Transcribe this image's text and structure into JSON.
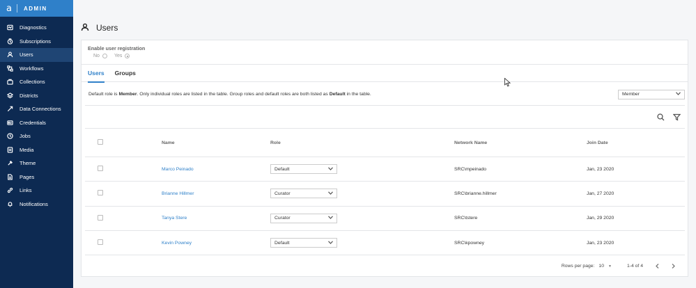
{
  "brand": {
    "logo": "a",
    "title": "ADMIN"
  },
  "sidebar": {
    "items": [
      {
        "label": "Diagnostics",
        "icon": "diagnostics-icon",
        "active": false
      },
      {
        "label": "Subscriptions",
        "icon": "subscriptions-icon",
        "active": false
      },
      {
        "label": "Users",
        "icon": "user-icon",
        "active": true
      },
      {
        "label": "Workflows",
        "icon": "workflows-icon",
        "active": false
      },
      {
        "label": "Collections",
        "icon": "collections-icon",
        "active": false
      },
      {
        "label": "Districts",
        "icon": "districts-icon",
        "active": false
      },
      {
        "label": "Data Connections",
        "icon": "data-connections-icon",
        "active": false
      },
      {
        "label": "Credentials",
        "icon": "credentials-icon",
        "active": false
      },
      {
        "label": "Jobs",
        "icon": "jobs-icon",
        "active": false
      },
      {
        "label": "Media",
        "icon": "media-icon",
        "active": false
      },
      {
        "label": "Theme",
        "icon": "theme-icon",
        "active": false
      },
      {
        "label": "Pages",
        "icon": "pages-icon",
        "active": false
      },
      {
        "label": "Links",
        "icon": "links-icon",
        "active": false
      },
      {
        "label": "Notifications",
        "icon": "notifications-icon",
        "active": false
      }
    ]
  },
  "header": {
    "title": "Users",
    "icon": "user-icon"
  },
  "registration": {
    "label": "Enable user registration",
    "option_no": "No",
    "option_yes": "Yes",
    "selected": "Yes"
  },
  "tabs": [
    {
      "label": "Users",
      "active": true
    },
    {
      "label": "Groups",
      "active": false
    }
  ],
  "info": {
    "prefix": "Default role is ",
    "role": "Member",
    "middle": ". Only individual roles are listed in the table. Group roles and default roles are both listed as ",
    "default_word": "Default",
    "suffix": " in the table.",
    "default_role_select": "Member"
  },
  "table": {
    "columns": {
      "name": "Name",
      "role": "Role",
      "network": "Network Name",
      "join": "Join Date"
    },
    "rows": [
      {
        "name": "Marco Peinado",
        "role": "Default",
        "network": "SRC\\mpeinado",
        "join": "Jan, 23 2020"
      },
      {
        "name": "Brianne Hillmer",
        "role": "Curator",
        "network": "SRC\\brianne.hillmer",
        "join": "Jan, 27 2020"
      },
      {
        "name": "Tanya Stere",
        "role": "Curator",
        "network": "SRC\\tstere",
        "join": "Jan, 29 2020"
      },
      {
        "name": "Kevin Powney",
        "role": "Default",
        "network": "SRC\\kpowney",
        "join": "Jan, 23 2020"
      }
    ]
  },
  "pager": {
    "rows_label": "Rows per page:",
    "rows_value": "10",
    "range": "1-4 of 4"
  },
  "colors": {
    "sidebar": "#0d2a52",
    "brand": "#2f80c9",
    "accent": "#2f80c9",
    "active_item": "#1f4574"
  }
}
